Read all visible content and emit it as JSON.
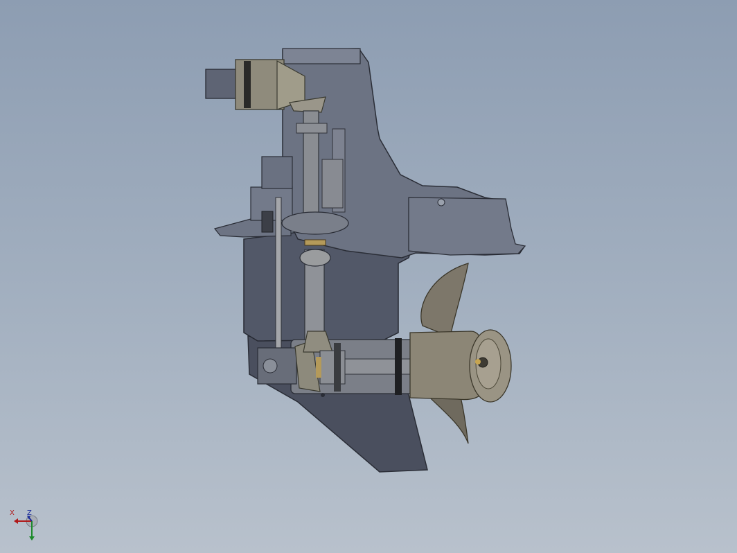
{
  "viewport": {
    "background_top": "#8d9db2",
    "background_bottom": "#b8c1cc",
    "model": "outboard-lower-unit-cutaway"
  },
  "triad": {
    "x_label": "X",
    "z_label": "Z",
    "x_color": "#b01818",
    "y_color": "#1c8a2a",
    "z_color": "#1a2a9a"
  }
}
